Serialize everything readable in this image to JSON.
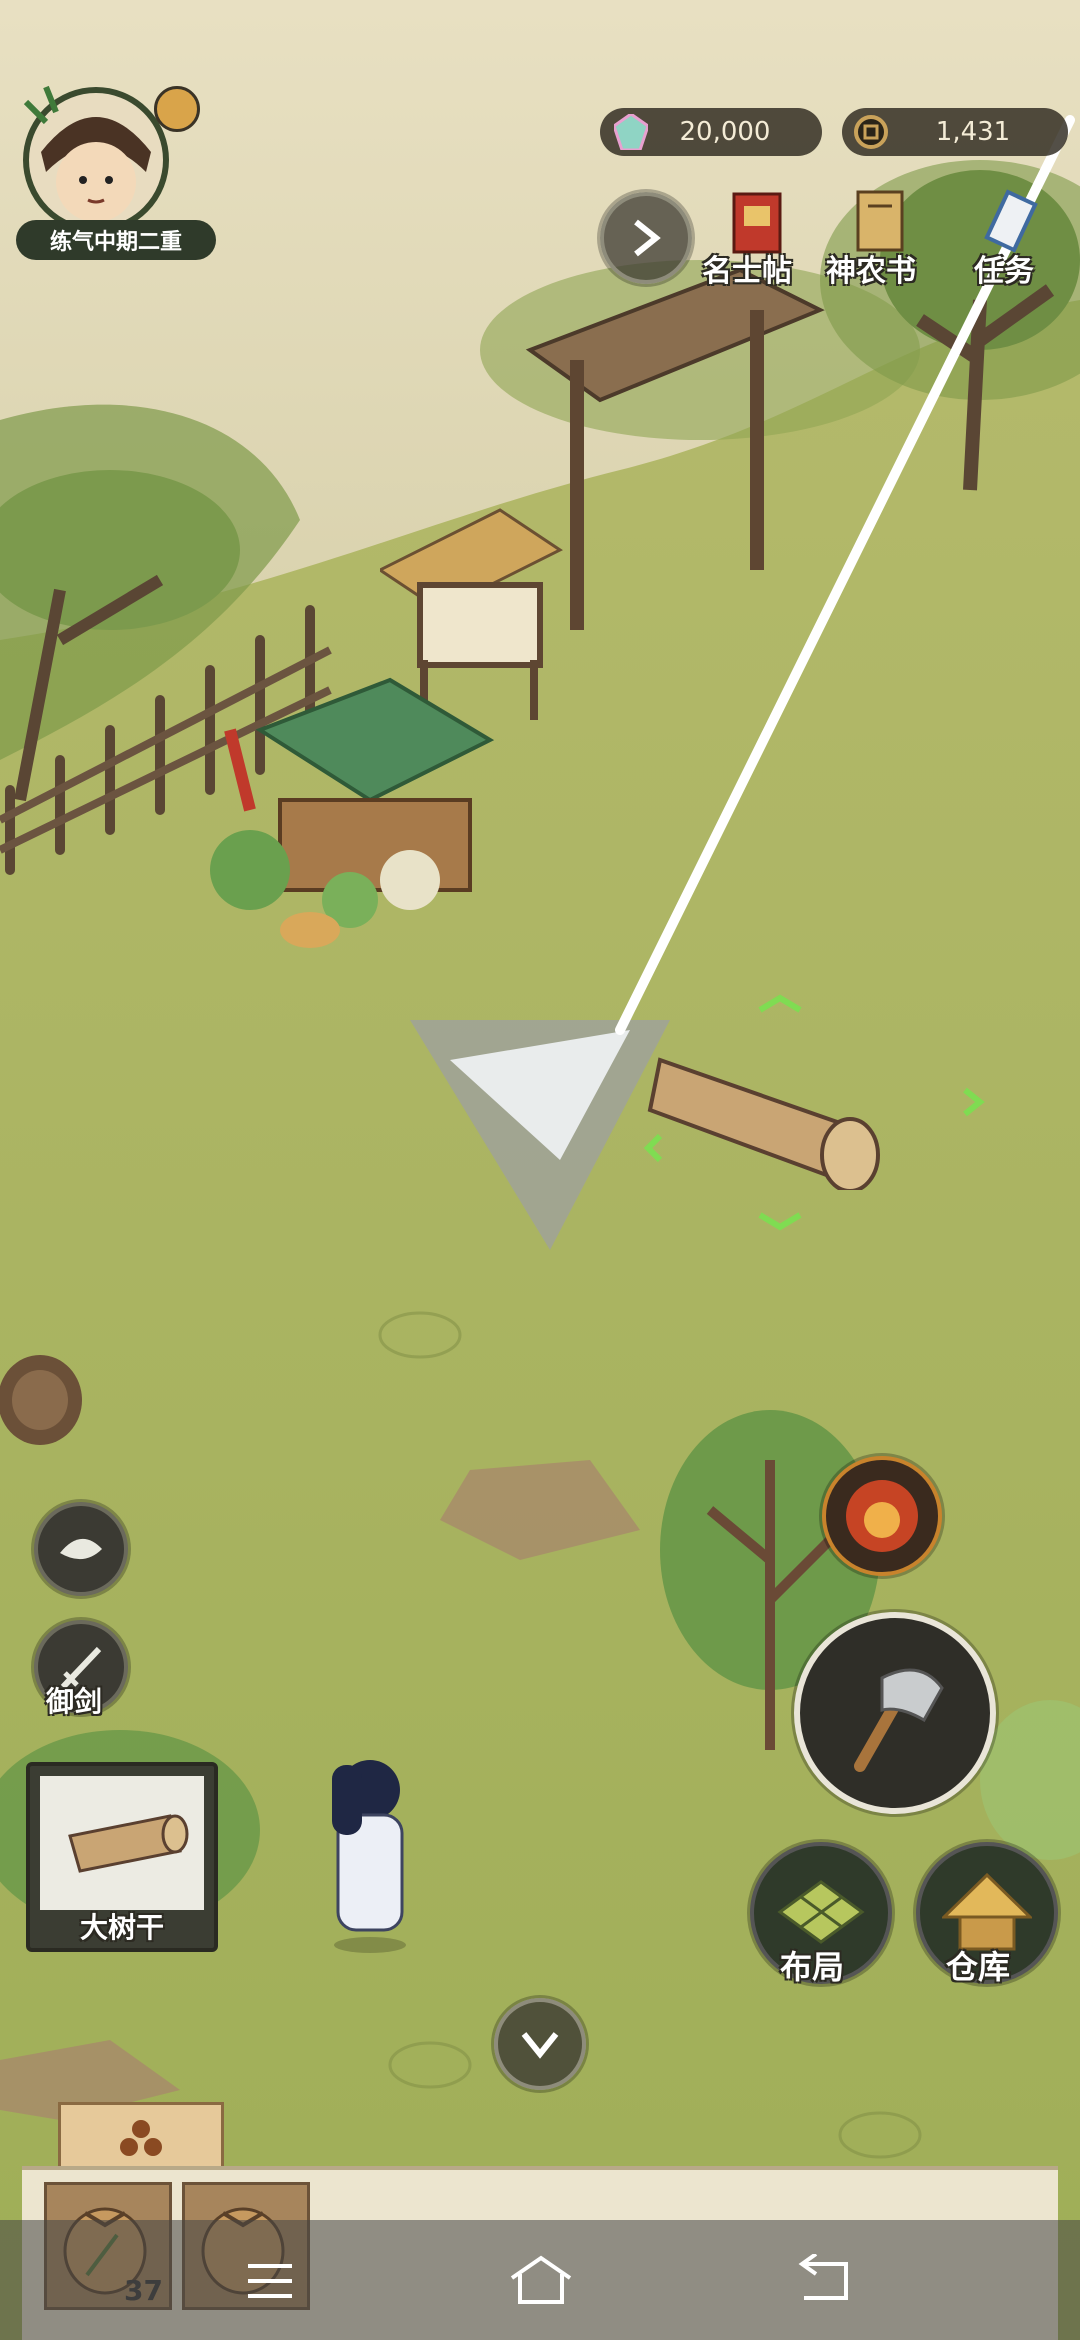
{
  "player": {
    "level_label": "练气中期二重"
  },
  "currency": {
    "gems": "20,000",
    "coins": "1,431"
  },
  "top_menu": [
    {
      "label": "名士帖",
      "icon": "invitation-icon"
    },
    {
      "label": "神农书",
      "icon": "book-icon"
    },
    {
      "label": "任务",
      "icon": "scroll-icon"
    }
  ],
  "left_tools": {
    "sword_label": "御剑",
    "target_label": "大树干"
  },
  "right_actions": {
    "layout_label": "布局",
    "storage_label": "仓库"
  },
  "inventory": {
    "seed_count": "37"
  },
  "colors": {
    "grass": "#a9b25c",
    "ink": "#2c2a22",
    "accent_orange": "#d0892a"
  }
}
